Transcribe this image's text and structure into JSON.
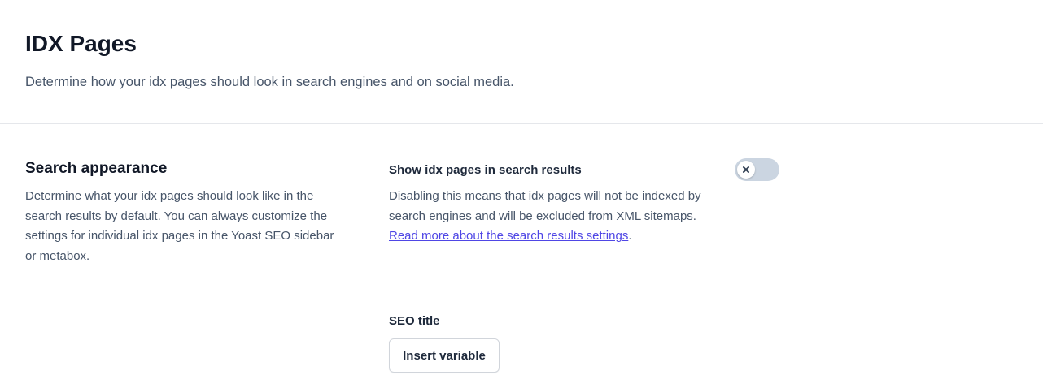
{
  "header": {
    "title": "IDX Pages",
    "description": "Determine how your idx pages should look in search engines and on social media."
  },
  "search_appearance": {
    "title": "Search appearance",
    "description": "Determine what your idx pages should look like in the search results by default. You can always customize the settings for individual idx pages in the Yoast SEO sidebar or metabox."
  },
  "show_in_search": {
    "label": "Show idx pages in search results",
    "description_prefix": "Disabling this means that idx pages will not be indexed by search engines and will be excluded from XML sitemaps. ",
    "link_text": "Read more about the search results settings",
    "description_suffix": ".",
    "toggle_state": "off",
    "toggle_icon": "x-icon"
  },
  "seo_title": {
    "label": "SEO title",
    "insert_variable_label": "Insert variable"
  },
  "colors": {
    "link": "#4f46e5",
    "toggle_off": "#cbd5e1"
  }
}
